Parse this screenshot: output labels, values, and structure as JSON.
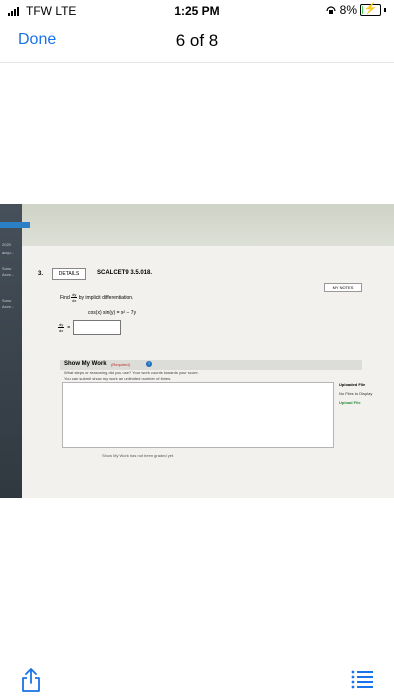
{
  "status_bar": {
    "carrier": "TFW  LTE",
    "time": "1:25 PM",
    "battery_percent": "8%",
    "battery_level": 0.08
  },
  "nav": {
    "done_label": "Done",
    "title": "6 of 8"
  },
  "photo": {
    "left_sidebar": [
      "2020",
      "acqu...",
      "Sunu",
      "Acce...",
      "Sunu",
      "Acce..."
    ],
    "question_number": "3.",
    "details_label": "DETAILS",
    "question_id": "SCALCET9 3.5.018.",
    "my_notes_label": "MY NOTES",
    "find_text": "Find",
    "find_num": "dy",
    "find_den": "dx",
    "find_suffix": "by implicit differentiation.",
    "equation": "cos(x) sin(y) = x² − 7y",
    "answer_num": "dy",
    "answer_den": "dx",
    "answer_eq": "=",
    "show_work_label": "Show My Work",
    "required_label": "(Required)",
    "help_icon_glyph": "?",
    "instruction_1": "What steps or reasoning did you use? Your work counts towards your score.",
    "instruction_2": "You can submit show my work an unlimited number of times.",
    "uploaded_files_label": "Uploaded File",
    "no_files_label": "No Files to Display",
    "upload_file_label": "Upload File",
    "not_graded_text": "Show My Work has not been graded yet."
  },
  "toolbar": {
    "share_icon": "share-icon",
    "list_icon": "list-icon"
  },
  "colors": {
    "accent": "#1a73e8",
    "battery": "#4cd964"
  }
}
